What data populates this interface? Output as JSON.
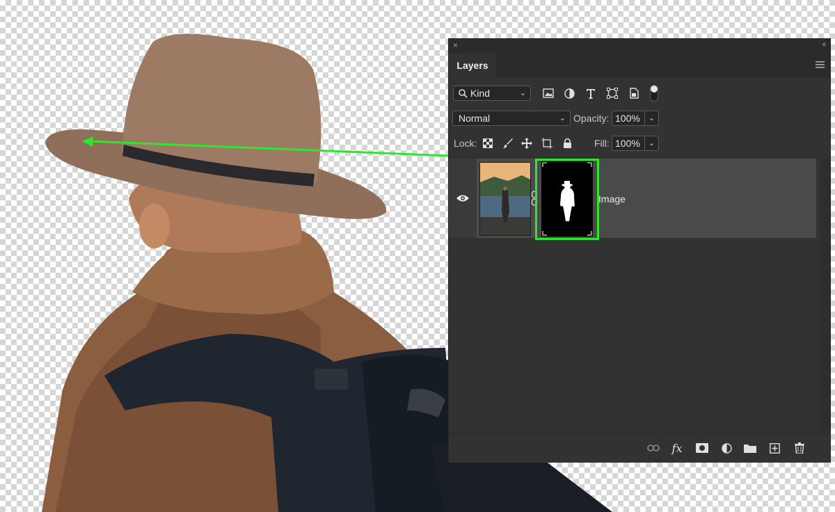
{
  "panel": {
    "tab_title": "Layers",
    "close_glyph": "×",
    "collapse_glyph": "‹‹",
    "filter": {
      "label": "Kind",
      "icon": "search-icon"
    },
    "filter_icons": [
      "image-filter-icon",
      "adjustment-filter-icon",
      "type-filter-icon",
      "shape-filter-icon",
      "smart-object-filter-icon",
      "filter-toggle-switch"
    ],
    "blend_mode": "Normal",
    "opacity_label": "Opacity:",
    "opacity_value": "100%",
    "lock_label": "Lock:",
    "lock_icons": [
      "lock-transparent-pixels-icon",
      "lock-image-pixels-icon",
      "lock-position-icon",
      "lock-artboard-icon",
      "lock-all-icon"
    ],
    "fill_label": "Fill:",
    "fill_value": "100%",
    "layers": [
      {
        "name": "Image",
        "visible": true,
        "has_mask": true,
        "mask_highlighted": true
      }
    ],
    "bottom_icons": [
      "link-layers-icon",
      "fx-icon",
      "add-mask-icon",
      "adjustment-layer-icon",
      "group-folder-icon",
      "new-layer-icon",
      "trash-icon"
    ],
    "fx_label": "fx"
  },
  "annotation": {
    "arrow_color": "#2ee62e",
    "highlight_color": "#2ee62e"
  },
  "colors": {
    "panel_bg": "#323232",
    "row_selected": "#4a4a4a",
    "accent": "#2ee62e"
  }
}
